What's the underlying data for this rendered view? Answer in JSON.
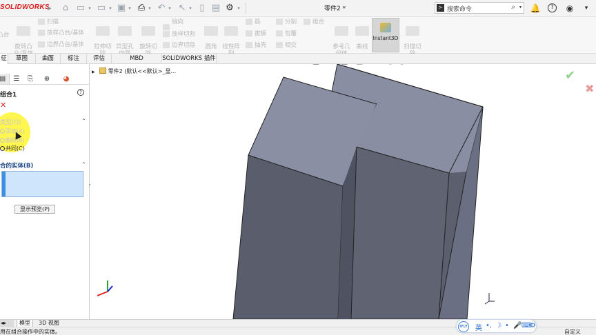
{
  "titlebar": {
    "app_name": "SOLIDWORKS",
    "document_title": "零件2 *",
    "search_placeholder": "搜索命令",
    "search_cmd_glyph": ">",
    "help_glyph": "?"
  },
  "ribbon": {
    "buttons_large": [
      {
        "name": "revolve-boss",
        "label": "旋转凸\n台/基体"
      },
      {
        "name": "extrude-cut",
        "label": "拉伸切\n除"
      },
      {
        "name": "hole-wizard",
        "label": "异型孔\n向导"
      },
      {
        "name": "revolve-cut",
        "label": "旋转切\n除"
      },
      {
        "name": "fillet",
        "label": "圆角"
      },
      {
        "name": "linear-pattern",
        "label": "线性阵\n列"
      },
      {
        "name": "ref-geometry",
        "label": "参考几\n何体"
      },
      {
        "name": "curves",
        "label": "曲线"
      },
      {
        "name": "instant3d",
        "label": "Instant3D"
      },
      {
        "name": "sweep-cut",
        "label": "扫描切\n除"
      }
    ],
    "buttons_small": [
      {
        "name": "sweep",
        "label": "扫描"
      },
      {
        "name": "loft-boss",
        "label": "放样凸台/基体"
      },
      {
        "name": "boundary-boss",
        "label": "边界凸台/基体"
      },
      {
        "name": "loft-cut",
        "label": "放样切割"
      },
      {
        "name": "boundary-cut",
        "label": "边界切除"
      },
      {
        "name": "rib",
        "label": "筋"
      },
      {
        "name": "draft",
        "label": "拔模"
      },
      {
        "name": "shell",
        "label": "抽壳"
      },
      {
        "name": "wrap",
        "label": "包覆"
      },
      {
        "name": "intersect",
        "label": "相交"
      },
      {
        "name": "mirror",
        "label": "镜向"
      },
      {
        "name": "split",
        "label": "分割"
      },
      {
        "name": "combine",
        "label": "组合"
      }
    ]
  },
  "tabs": [
    {
      "name": "tab-features",
      "label": "征",
      "active": true
    },
    {
      "name": "tab-sketch",
      "label": "草图",
      "active": false
    },
    {
      "name": "tab-surfaces",
      "label": "曲面",
      "active": false
    },
    {
      "name": "tab-annotation",
      "label": "标注",
      "active": false
    },
    {
      "name": "tab-evaluate",
      "label": "评估",
      "active": false
    },
    {
      "name": "tab-mbd",
      "label": "MBD Dimensions",
      "active": false
    },
    {
      "name": "tab-addins",
      "label": "SOLIDWORKS 插件",
      "active": false
    }
  ],
  "property_manager": {
    "title": "组合1",
    "type_section_label": "类型(O)",
    "operations": [
      {
        "label": "添加(A)",
        "checked": true
      },
      {
        "label": "删除(B)",
        "checked": false
      },
      {
        "label": "共同(C)",
        "checked": false
      }
    ],
    "bodies_section_label": "合的实体(B)",
    "preview_button": "显示预览(P)"
  },
  "feature_tree": {
    "part_label": "零件2 (默认<<默认>_显..."
  },
  "bottom_tabs": [
    {
      "label": "3D 视图"
    },
    {
      "label": "模型"
    }
  ],
  "status": {
    "message": "用在组合操作中的实体。",
    "right_label": "自定义"
  },
  "ime": {
    "logo": "iFLY",
    "lang": "英"
  },
  "colors": {
    "body_front": "#5f6473",
    "body_top": "#8a8fa3",
    "body_side": "#6c7084",
    "selection": "#cfe5fb",
    "highlight": "#fff51e"
  }
}
